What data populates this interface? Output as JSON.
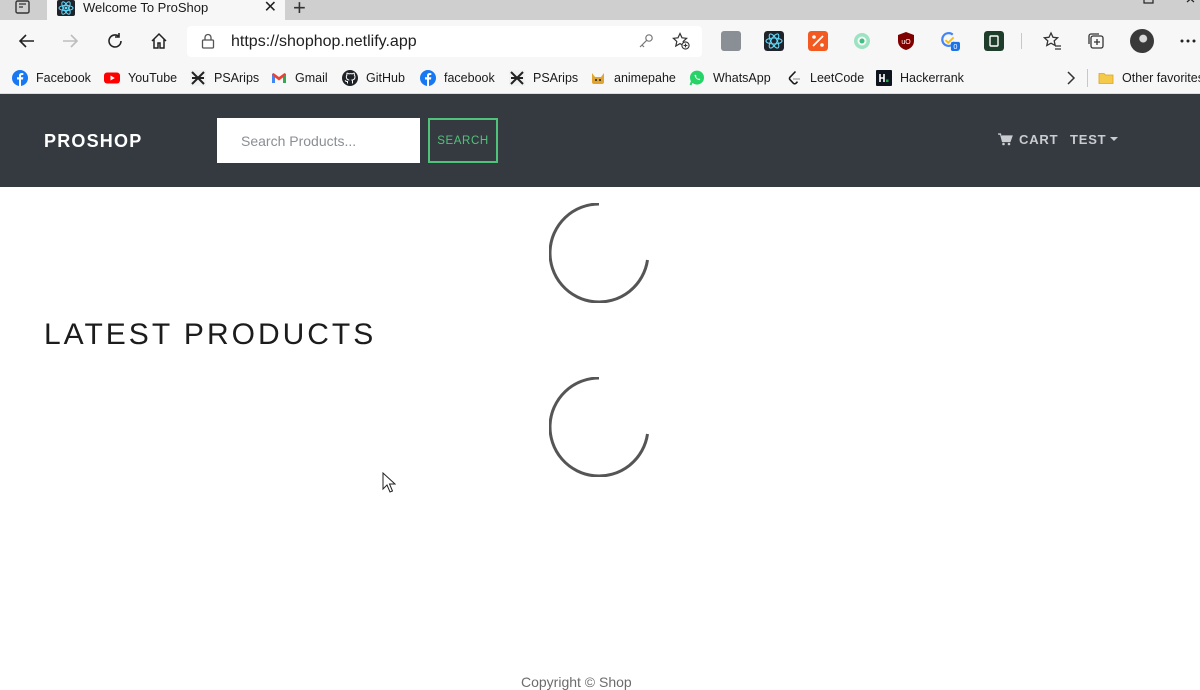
{
  "browser": {
    "tab": {
      "title": "Welcome To ProShop"
    },
    "address": {
      "url": "https://shophop.netlify.app"
    },
    "bookmarks": [
      {
        "label": "Facebook",
        "icon": "facebook-icon",
        "color": "#1877f2"
      },
      {
        "label": "YouTube",
        "icon": "youtube-icon",
        "color": "#ff0000"
      },
      {
        "label": "PSArips",
        "icon": "psarips-icon",
        "color": "#333333"
      },
      {
        "label": "Gmail",
        "icon": "gmail-icon",
        "color": "#ea4335"
      },
      {
        "label": "GitHub",
        "icon": "github-icon",
        "color": "#1f2328"
      },
      {
        "label": "facebook",
        "icon": "facebook-icon",
        "color": "#1877f2"
      },
      {
        "label": "PSArips",
        "icon": "psarips-icon",
        "color": "#333333"
      },
      {
        "label": "animepahe",
        "icon": "animepahe-icon",
        "color": "#e0a530"
      },
      {
        "label": "WhatsApp",
        "icon": "whatsapp-icon",
        "color": "#25d366"
      },
      {
        "label": "LeetCode",
        "icon": "leetcode-icon",
        "color": "#1a1a1a"
      },
      {
        "label": "Hackerrank",
        "icon": "hackerrank-icon",
        "color": "#0e141e"
      }
    ],
    "other_favorites": "Other favorites"
  },
  "site": {
    "brand": "PROSHOP",
    "search": {
      "placeholder": "Search Products...",
      "button_label": "SEARCH"
    },
    "nav": {
      "cart_label": "CART",
      "user_label": "TEST"
    },
    "section_title": "LATEST PRODUCTS",
    "footer": "Copyright © Shop"
  },
  "colors": {
    "header_bg": "#343a40",
    "accent_green": "#51c27a",
    "nav_text": "#c9ccd0",
    "spinner": "#555555"
  }
}
